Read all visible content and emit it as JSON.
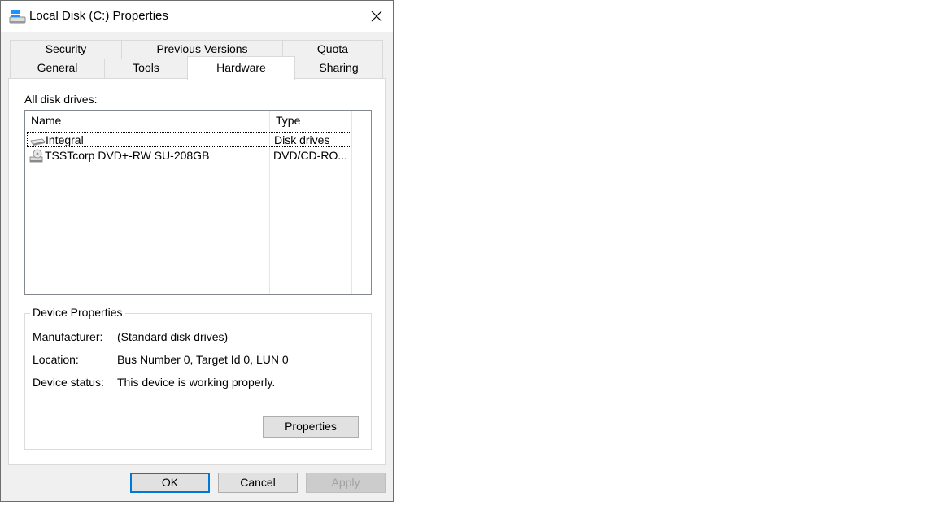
{
  "window": {
    "title": "Local Disk (C:) Properties",
    "icons": {
      "app": "drive-icon",
      "close": "close-icon"
    }
  },
  "tabs": {
    "back_row": [
      "Security",
      "Previous Versions",
      "Quota"
    ],
    "front_row": [
      "General",
      "Tools",
      "Hardware",
      "Sharing"
    ],
    "active": "Hardware"
  },
  "hardware": {
    "list_label": "All disk drives:",
    "columns": [
      "Name",
      "Type"
    ],
    "rows": [
      {
        "name": "Integral",
        "type": "Disk drives",
        "icon": "disk-drive-icon",
        "focused": true
      },
      {
        "name": "TSSTcorp DVD+-RW SU-208GB",
        "type": "DVD/CD-RO...",
        "icon": "dvd-drive-icon",
        "focused": false
      }
    ]
  },
  "device_properties": {
    "legend": "Device Properties",
    "manufacturer_label": "Manufacturer:",
    "manufacturer_value": "(Standard disk drives)",
    "location_label": "Location:",
    "location_value": "Bus Number 0, Target Id 0, LUN 0",
    "status_label": "Device status:",
    "status_value": "This device is working properly.",
    "properties_button": "Properties"
  },
  "buttons": {
    "ok": "OK",
    "cancel": "Cancel",
    "apply": "Apply",
    "apply_enabled": false
  },
  "colors": {
    "window_bg": "#f0f0f0",
    "focus_border": "#0078d7",
    "disabled_text": "#a0a0a0"
  }
}
